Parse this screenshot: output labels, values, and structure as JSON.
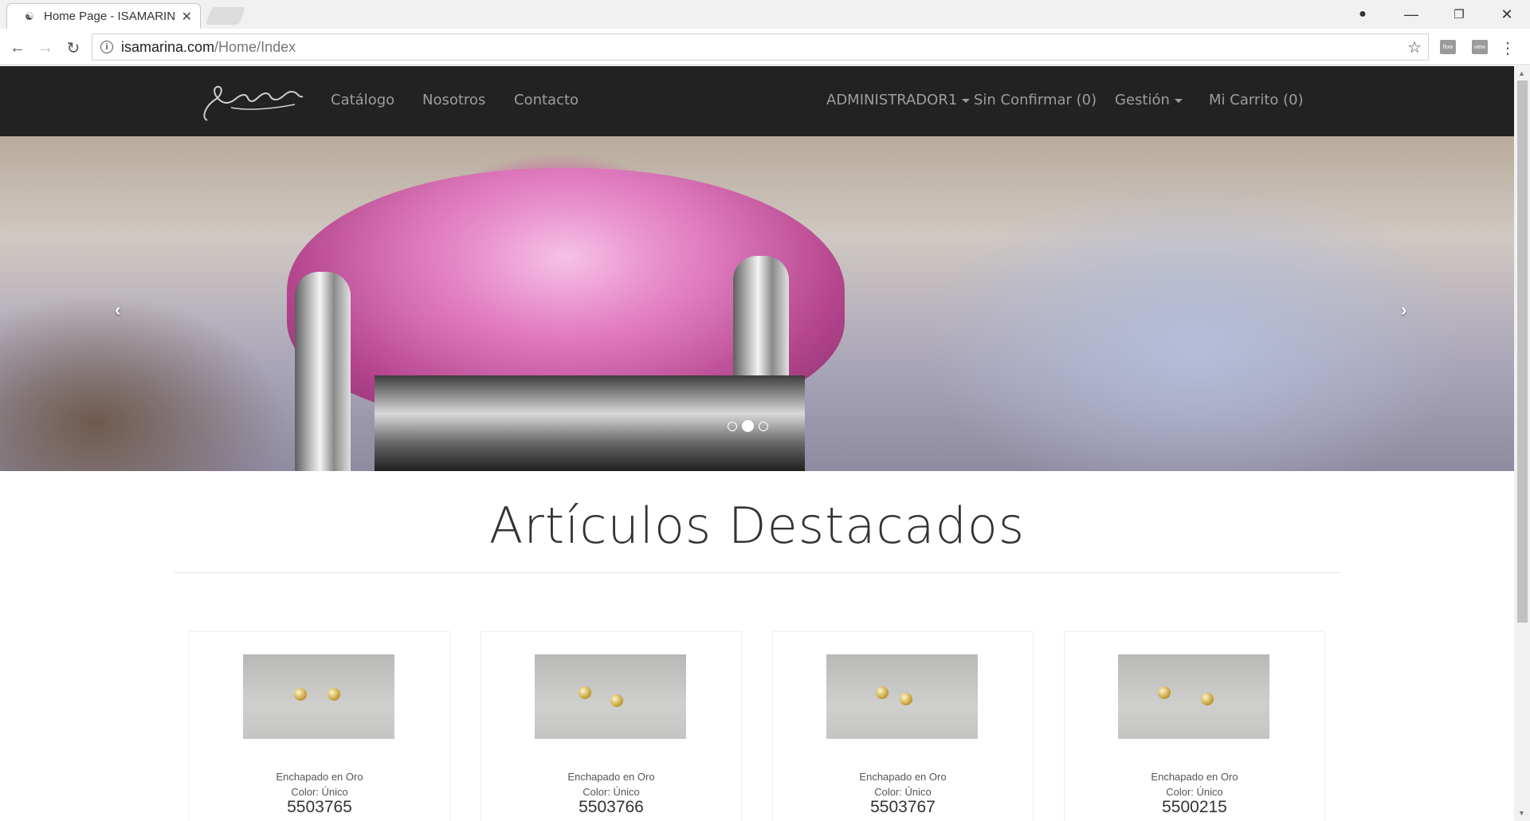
{
  "browser": {
    "tab_title": "Home Page - ISAMARINA",
    "url_host": "isamarina.com",
    "url_path": "/Home/Index",
    "extensions": [
      "flow",
      "view"
    ]
  },
  "navbar": {
    "logo_text": "Ysa Marina",
    "links": [
      "Catálogo",
      "Nosotros",
      "Contacto"
    ],
    "user_menu": "ADMINISTRADOR1",
    "unconfirmed": "Sin Confirmar (0)",
    "management": "Gestión",
    "cart": "Mi Carrito (0)"
  },
  "carousel": {
    "slide_count": 3,
    "active_slide": 2,
    "prev_glyph": "‹",
    "next_glyph": "›"
  },
  "featured": {
    "heading": "Artículos Destacados",
    "products": [
      {
        "material": "Enchapado en Oro",
        "color": "Color: Único",
        "code": "5503765"
      },
      {
        "material": "Enchapado en Oro",
        "color": "Color: Único",
        "code": "5503766"
      },
      {
        "material": "Enchapado en Oro",
        "color": "Color: Único",
        "code": "5503767"
      },
      {
        "material": "Enchapado en Oro",
        "color": "Color: Único",
        "code": "5500215"
      }
    ]
  }
}
